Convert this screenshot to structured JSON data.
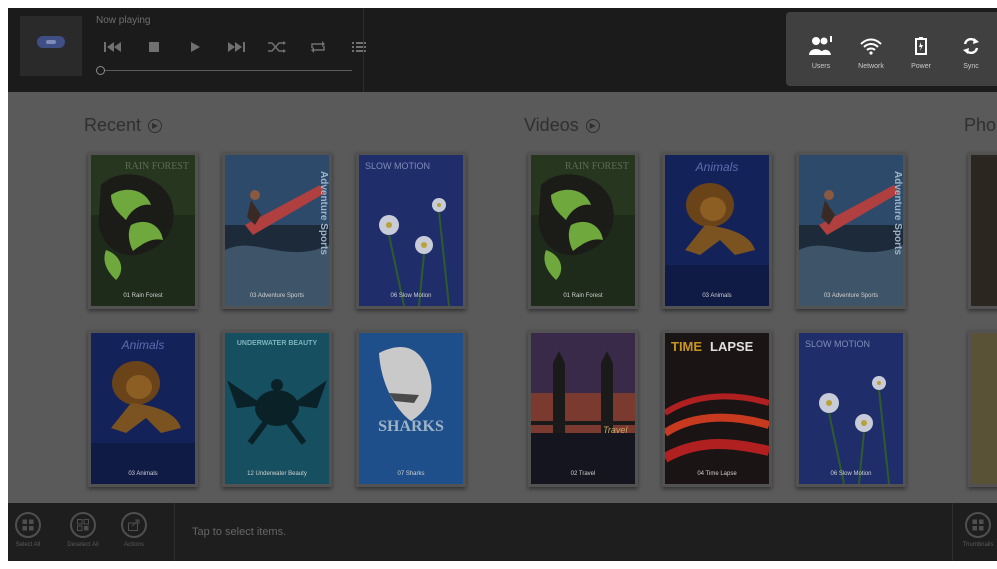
{
  "player": {
    "now_playing_label": "Now playing",
    "controls": [
      {
        "name": "previous-icon"
      },
      {
        "name": "stop-icon"
      },
      {
        "name": "play-icon"
      },
      {
        "name": "next-icon"
      },
      {
        "name": "shuffle-icon"
      },
      {
        "name": "repeat-icon"
      },
      {
        "name": "playlist-icon"
      }
    ],
    "progress": 0
  },
  "status": {
    "items": [
      {
        "name": "users",
        "label": "Users",
        "icon": "users-icon"
      },
      {
        "name": "network",
        "label": "Network",
        "icon": "wifi-icon"
      },
      {
        "name": "power",
        "label": "Power",
        "icon": "battery-icon"
      },
      {
        "name": "sync",
        "label": "Sync",
        "icon": "sync-icon"
      }
    ]
  },
  "sections": [
    {
      "title": "Recent",
      "tiles": [
        {
          "title": "01 Rain Forest",
          "art": "frog"
        },
        {
          "title": "03 Adventure Sports",
          "art": "surf"
        },
        {
          "title": "06 Slow Motion",
          "art": "flowers"
        },
        {
          "title": "03 Animals",
          "art": "lion"
        },
        {
          "title": "12 Underwater Beauty",
          "art": "turtle"
        },
        {
          "title": "07 Sharks",
          "art": "shark"
        }
      ]
    },
    {
      "title": "Videos",
      "tiles": [
        {
          "title": "01 Rain Forest",
          "art": "frog"
        },
        {
          "title": "03 Animals",
          "art": "lion"
        },
        {
          "title": "03 Adventure Sports",
          "art": "surf"
        },
        {
          "title": "02 Travel",
          "art": "bridge"
        },
        {
          "title": "04 Time Lapse",
          "art": "lapse"
        },
        {
          "title": "06 Slow Motion",
          "art": "flowers"
        }
      ]
    },
    {
      "title": "Pho",
      "tiles": []
    }
  ],
  "art_text": {
    "rain_forest": "RAIN FOREST",
    "adventure_sports": "Adventure Sports",
    "slow_motion": "SLOW MOTION",
    "animals": "Animals",
    "underwater_beauty": "UNDERWATER BEAUTY",
    "sharks": "SHARKS",
    "travel": "Travel",
    "time": "TIME",
    "lapse": "LAPSE"
  },
  "bottom": {
    "select_all": "Select All",
    "deselect_all": "Deselect All",
    "actions": "Actions",
    "hint": "Tap to select items.",
    "thumbnails": "Thumbnails"
  }
}
